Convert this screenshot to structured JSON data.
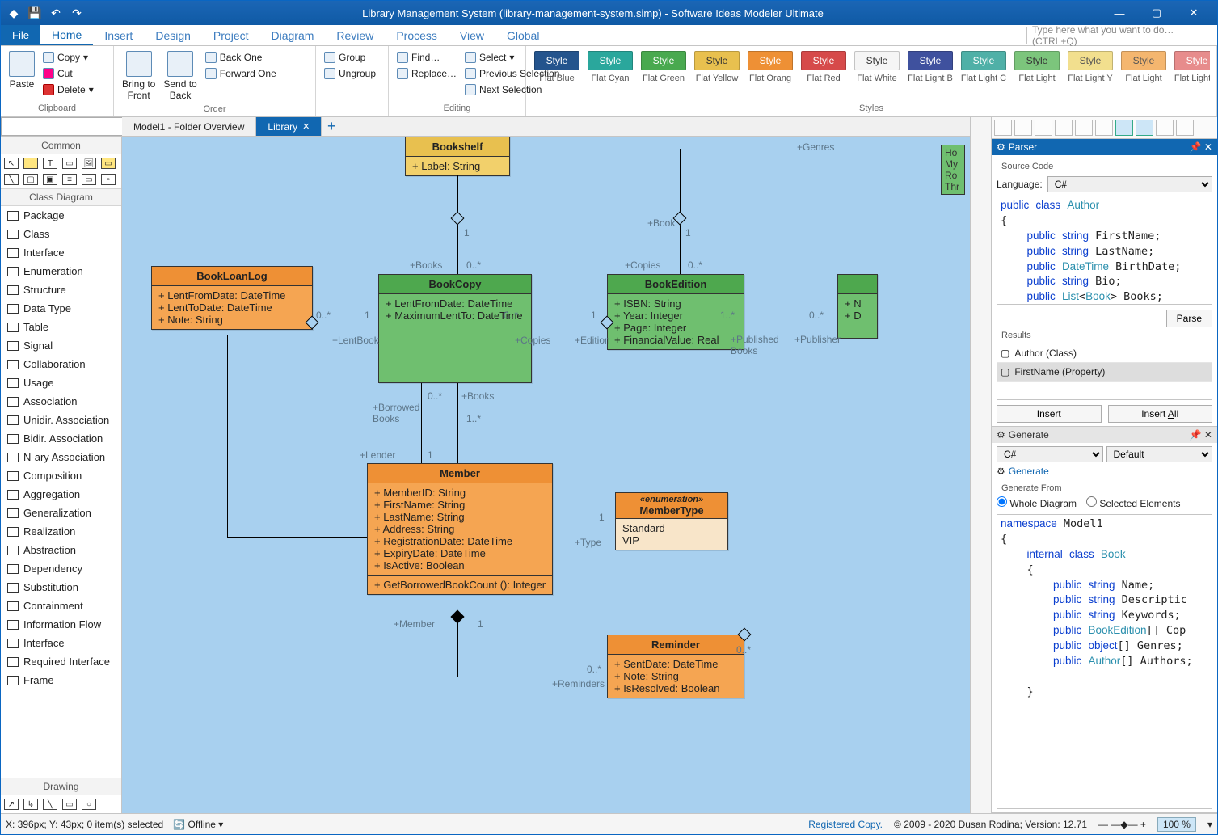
{
  "title": "Library Management System (library-management-system.simp) - Software Ideas Modeler Ultimate",
  "quick_access": [
    "save",
    "undo",
    "redo"
  ],
  "menu": {
    "file": "File",
    "tabs": [
      "Home",
      "Insert",
      "Design",
      "Project",
      "Diagram",
      "Review",
      "Process",
      "View",
      "Global"
    ],
    "active": "Home",
    "search_placeholder": "Type here what you want to do… (CTRL+Q)"
  },
  "ribbon": {
    "clipboard": {
      "label": "Clipboard",
      "paste": "Paste",
      "copy": "Copy",
      "cut": "Cut",
      "delete": "Delete"
    },
    "order": {
      "label": "Order",
      "bring": "Bring to\nFront",
      "send": "Send to\nBack",
      "backone": "Back One",
      "forwardone": "Forward One",
      "group": "Group",
      "ungroup": "Ungroup"
    },
    "editing": {
      "label": "Editing",
      "find": "Find…",
      "replace": "Replace…",
      "select": "Select",
      "prevsel": "Previous Selection",
      "nextsel": "Next Selection"
    },
    "styles": {
      "label": "Styles",
      "chip": "Style",
      "swatches": [
        {
          "bg": "#24548d",
          "fg": "#fff",
          "lab": "Flat Blue"
        },
        {
          "bg": "#2aa79c",
          "fg": "#fff",
          "lab": "Flat Cyan"
        },
        {
          "bg": "#49a94f",
          "fg": "#fff",
          "lab": "Flat Green"
        },
        {
          "bg": "#e8c04f",
          "fg": "#333",
          "lab": "Flat Yellow"
        },
        {
          "bg": "#ee9035",
          "fg": "#fff",
          "lab": "Flat Orang"
        },
        {
          "bg": "#d64a4a",
          "fg": "#fff",
          "lab": "Flat Red"
        },
        {
          "bg": "#f5f5f5",
          "fg": "#333",
          "lab": "Flat White"
        },
        {
          "bg": "#3f519e",
          "fg": "#fff",
          "lab": "Flat Light B"
        },
        {
          "bg": "#4fb0a7",
          "fg": "#fff",
          "lab": "Flat Light C"
        },
        {
          "bg": "#7cc57c",
          "fg": "#333",
          "lab": "Flat Light"
        },
        {
          "bg": "#f2df8e",
          "fg": "#555",
          "lab": "Flat Light Y"
        },
        {
          "bg": "#f4b66f",
          "fg": "#555",
          "lab": "Flat Light"
        },
        {
          "bg": "#e78c8c",
          "fg": "#fff",
          "lab": "Flat Light R"
        }
      ]
    }
  },
  "left_panel": {
    "common_header": "Common",
    "class_header": "Class Diagram",
    "drawing_header": "Drawing",
    "class_items": [
      "Package",
      "Class",
      "Interface",
      "Enumeration",
      "Structure",
      "Data Type",
      "Table",
      "Signal",
      "Collaboration",
      "Usage",
      "Association",
      "Unidir. Association",
      "Bidir. Association",
      "N-ary Association",
      "Composition",
      "Aggregation",
      "Generalization",
      "Realization",
      "Abstraction",
      "Dependency",
      "Substitution",
      "Containment",
      "Information Flow",
      "Interface",
      "Required Interface",
      "Frame"
    ]
  },
  "doc_tabs": {
    "t1": "Model1 - Folder Overview",
    "t2": "Library"
  },
  "diagram": {
    "boxes": {
      "bookshelf": {
        "title": "Bookshelf",
        "attrs": [
          "+ Label: String"
        ]
      },
      "bookloanlog": {
        "title": "BookLoanLog",
        "attrs": [
          "+ LentFromDate: DateTime",
          "+ LentToDate: DateTime",
          "+ Note: String"
        ]
      },
      "bookcopy": {
        "title": "BookCopy",
        "attrs": [
          "+ LentFromDate: DateTime",
          "+ MaximumLentTo: DateTime"
        ]
      },
      "bookedition": {
        "title": "BookEdition",
        "attrs": [
          "+ ISBN: String",
          "+ Year: Integer",
          "+ Page: Integer",
          "+ FinancialValue: Real"
        ]
      },
      "member": {
        "title": "Member",
        "attrs": [
          "+ MemberID: String",
          "+ FirstName: String",
          "+ LastName: String",
          "+ Address: String",
          "+ RegistrationDate: DateTime",
          "+ ExpiryDate: DateTime",
          "+ IsActive: Boolean"
        ],
        "ops": [
          "+ GetBorrowedBookCount (): Integer"
        ]
      },
      "membertype": {
        "stereo": "«enumeration»",
        "title": "MemberType",
        "literals": [
          "Standard",
          "VIP"
        ]
      },
      "reminder": {
        "title": "Reminder",
        "attrs": [
          "+ SentDate: DateTime",
          "+ Note: String",
          "+ IsResolved: Boolean"
        ]
      }
    },
    "labels": {
      "books": "+Books",
      "bookscount": "0..*",
      "one": "1",
      "onestar": "1..*",
      "lentbook": "+LentBook",
      "copies": "+Copies",
      "edition": "+Edition",
      "publishedbooks": "+Published\nBooks",
      "publisher": "+Publisher",
      "borrowedbooks": "+Borrowed\nBooks",
      "lender": "+Lender",
      "type": "+Type",
      "memberlab": "+Member",
      "reminders": "+Reminders",
      "book": "+Book",
      "genres": "+Genres",
      "zerostar": "0..*"
    },
    "partial": {
      "lines": [
        "Ho",
        "My",
        "Ro",
        "Thr"
      ]
    }
  },
  "parser": {
    "title": "Parser",
    "src_label": "Source Code",
    "lang_label": "Language:",
    "lang_value": "C#",
    "code": "public class Author\n{\n    public string FirstName;\n    public string LastName;\n    public DateTime BirthDate;\n    public string Bio;\n    public List<Book> Books;",
    "parse_btn": "Parse",
    "results_label": "Results",
    "results": [
      "Author (Class)",
      "FirstName (Property)"
    ],
    "insert": "Insert",
    "insertall": "Insert All"
  },
  "generate": {
    "title": "Generate",
    "lang": "C#",
    "template": "Default",
    "gen_btn": "Generate",
    "from_label": "Generate From",
    "whole": "Whole Diagram",
    "selected": "Selected Elements",
    "code": "namespace Model1\n{\n    internal class Book\n    {\n        public string Name;\n        public string Descriptic\n        public string Keywords;\n        public BookEdition[] Cop\n        public object[] Genres;\n        public Author[] Authors;\n\n    }"
  },
  "status": {
    "pos": "X: 396px; Y: 43px; 0 item(s) selected",
    "offline": "Offline",
    "reg": "Registered Copy.",
    "copyright": "© 2009 - 2020 Dusan Rodina; Version: 12.71",
    "zoom": "100 %"
  }
}
